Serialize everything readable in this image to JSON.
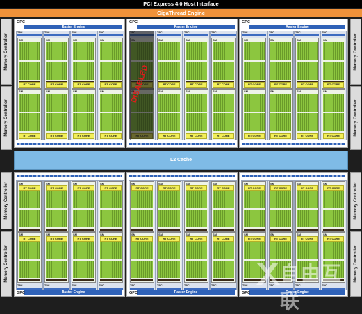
{
  "header": {
    "pcie_label": "PCI Express 4.0 Host Interface",
    "gigathread_label": "GigaThread Engine"
  },
  "memory_controller_label": "Memory Controller",
  "l2_label": "L2 Cache",
  "gpc_label": "GPC",
  "raster_label": "Raster Engine",
  "tpc_label": "TPC",
  "polymorph_label": "PolyMorph Engine",
  "sm_label": "SM",
  "rt_core_label": "RT CORE",
  "disabled_label": "DISABLED",
  "watermark_text": "自由互联",
  "colors": {
    "pcie_bar": "#000000",
    "gigathread_bar": "#f0923a",
    "l2_cache": "#7fbbe6",
    "raster_engine": "#2f62b8",
    "cuda_cores": "#8cc63f",
    "rt_core": "#f2ef5a",
    "disabled_text": "#e11b1b"
  },
  "gpcs": [
    {
      "row": "top",
      "disabled_tpc": null
    },
    {
      "row": "top",
      "disabled_tpc": 0
    },
    {
      "row": "top",
      "disabled_tpc": null
    },
    {
      "row": "bottom",
      "disabled_tpc": null
    },
    {
      "row": "bottom",
      "disabled_tpc": null
    },
    {
      "row": "bottom",
      "disabled_tpc": null
    }
  ]
}
